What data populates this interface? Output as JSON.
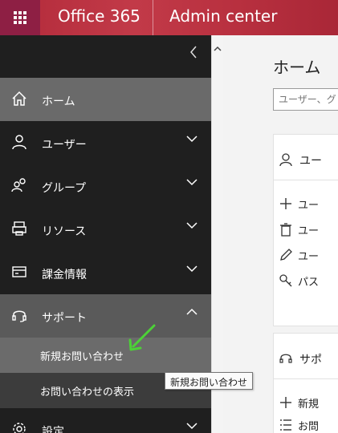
{
  "header": {
    "brand": "Office 365",
    "app_title": "Admin center"
  },
  "sidebar": {
    "items": [
      {
        "label": "ホーム",
        "icon": "home-icon"
      },
      {
        "label": "ユーザー",
        "icon": "user-icon"
      },
      {
        "label": "グループ",
        "icon": "group-icon"
      },
      {
        "label": "リソース",
        "icon": "resources-icon"
      },
      {
        "label": "課金情報",
        "icon": "billing-icon"
      },
      {
        "label": "サポート",
        "icon": "headset-icon"
      },
      {
        "label": "設定",
        "icon": "gear-icon"
      }
    ],
    "support_subitems": [
      {
        "label": "新規お問い合わせ"
      },
      {
        "label": "お問い合わせの表示"
      }
    ]
  },
  "main": {
    "title": "ホーム",
    "search_placeholder": "ユーザー、グ",
    "users_card": {
      "title": "ユー",
      "rows": [
        "ユー",
        "ユー",
        "ユー",
        "パス"
      ]
    },
    "support_card": {
      "title": "サポ",
      "rows": [
        "新規",
        "お問"
      ]
    }
  },
  "tooltip": {
    "text": "新規お問い合わせ"
  },
  "colors": {
    "topbar": "#b22a3a",
    "waffle": "#8e1f44",
    "sidebar": "#1f1f1f",
    "arrow": "#4cd137"
  }
}
